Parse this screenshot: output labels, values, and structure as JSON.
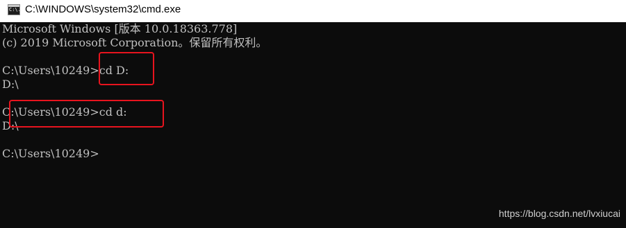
{
  "window": {
    "title": "C:\\WINDOWS\\system32\\cmd.exe",
    "icon_label": "C:\\."
  },
  "console": {
    "lines": [
      "Microsoft Windows [版本 10.0.18363.778]",
      "(c) 2019 Microsoft Corporation。保留所有权利。",
      "",
      "C:\\Users\\10249>cd D:",
      "D:\\",
      "",
      "C:\\Users\\10249>cd d:",
      "D:\\",
      "",
      "C:\\Users\\10249>"
    ]
  },
  "watermark": "https://blog.csdn.net/lvxiucai",
  "colors": {
    "console_bg": "#0c0c0c",
    "console_text": "#c0c0c0",
    "highlight": "#e8141e",
    "titlebar_bg": "#ffffff"
  }
}
